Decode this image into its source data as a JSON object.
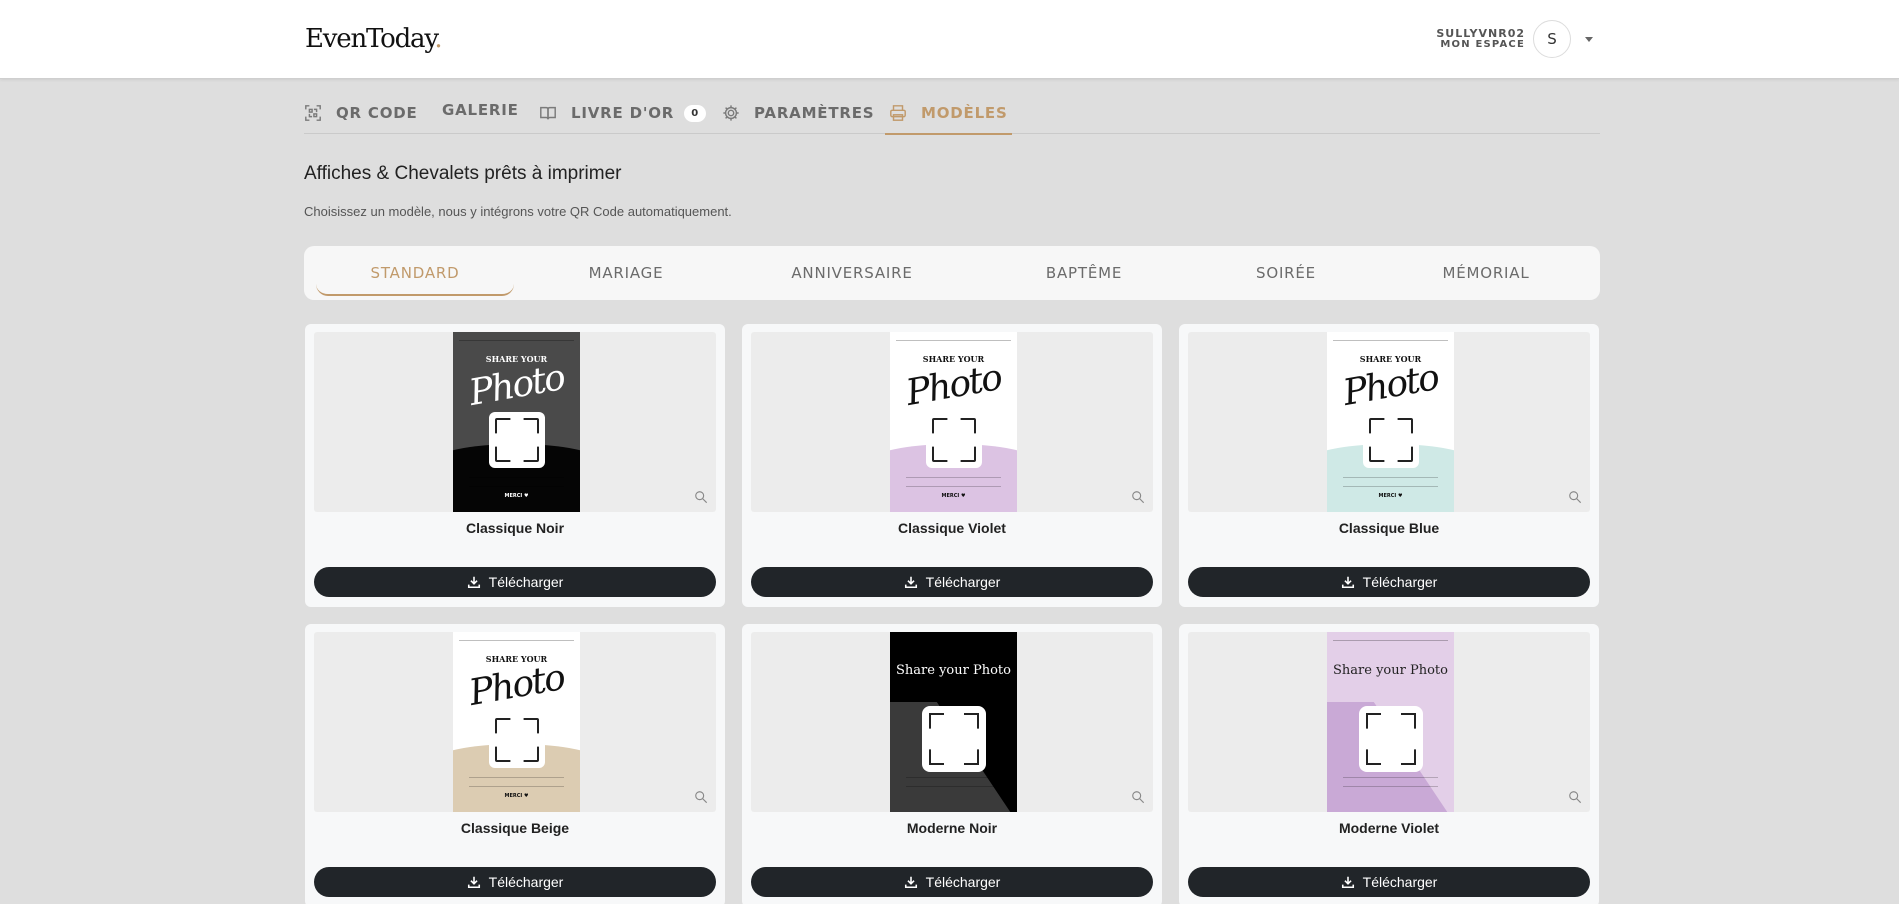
{
  "brand": {
    "logo_text": "EvenToday",
    "logo_dot": "."
  },
  "user": {
    "name": "SULLYVNR02",
    "space_label": "MON ESPACE",
    "avatar_initial": "S"
  },
  "nav": {
    "tabs": [
      {
        "label": "QR CODE",
        "icon": "qr-code-icon"
      },
      {
        "label": "GALERIE",
        "icon": ""
      },
      {
        "label": "LIVRE D'OR",
        "icon": "book-icon",
        "badge": "0"
      },
      {
        "label": "PARAMÈTRES",
        "icon": "gear-icon"
      },
      {
        "label": "MODÈLES",
        "icon": "printer-icon",
        "active": true
      }
    ]
  },
  "page": {
    "title": "Affiches & Chevalets prêts à imprimer",
    "subtitle": "Choisissez un modèle, nous y intégrons votre QR Code automatiquement."
  },
  "categories": [
    {
      "label": "STANDARD",
      "active": true
    },
    {
      "label": "MARIAGE"
    },
    {
      "label": "ANNIVERSAIRE"
    },
    {
      "label": "BAPTÊME"
    },
    {
      "label": "SOIRÉE"
    },
    {
      "label": "MÉMORIAL"
    }
  ],
  "poster_text": {
    "share_your": "SHARE YOUR",
    "photo": "Photo",
    "share_your_photo_title": "Share your Photo",
    "merci": "MERCI ♥"
  },
  "templates": [
    {
      "name": "Classique Noir",
      "download_label": "Télécharger",
      "style": "script",
      "bg": "#4a4a4a",
      "bottom": "#050505",
      "ink": "#ffffff"
    },
    {
      "name": "Classique Violet",
      "download_label": "Télécharger",
      "style": "script",
      "bg": "#ffffff",
      "bottom": "#dcc3e3",
      "ink": "#111111"
    },
    {
      "name": "Classique Blue",
      "download_label": "Télécharger",
      "style": "script",
      "bg": "#ffffff",
      "bottom": "#cfe9e6",
      "ink": "#111111"
    },
    {
      "name": "Classique Beige",
      "download_label": "Télécharger",
      "style": "script",
      "bg": "#ffffff",
      "bottom": "#dcccb2",
      "ink": "#111111"
    },
    {
      "name": "Moderne Noir",
      "download_label": "Télécharger",
      "style": "serif",
      "bg": "#000000",
      "bottom": "#3a3a3a",
      "ink": "#ffffff"
    },
    {
      "name": "Moderne Violet",
      "download_label": "Télécharger",
      "style": "serif",
      "bg": "#e3cfe8",
      "bottom": "#c9a9d6",
      "ink": "#222222"
    }
  ]
}
